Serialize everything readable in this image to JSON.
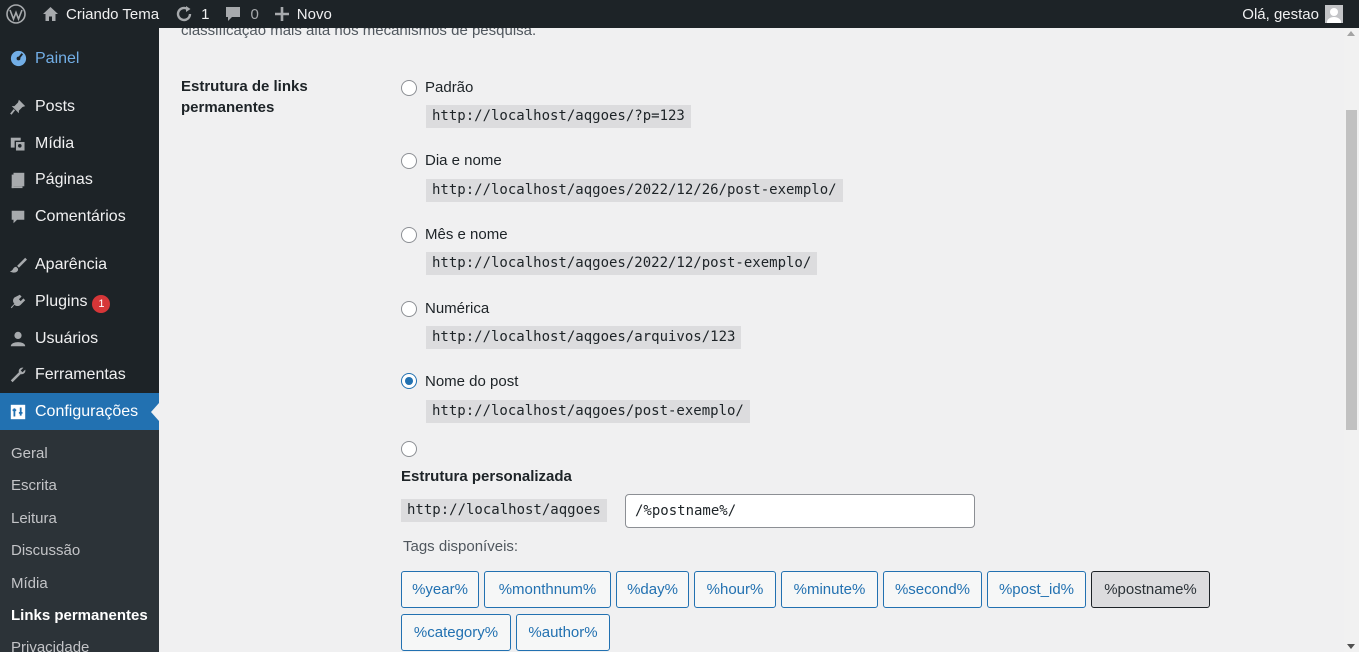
{
  "adminbar": {
    "site_name": "Criando Tema",
    "updates_count": "1",
    "comments_count": "0",
    "new_label": "Novo",
    "greeting": "Olá, gestao"
  },
  "sidebar": {
    "items": [
      {
        "label": "Painel",
        "icon": "dashboard-icon"
      },
      {
        "label": "Posts",
        "icon": "pushpin-icon"
      },
      {
        "label": "Mídia",
        "icon": "media-icon"
      },
      {
        "label": "Páginas",
        "icon": "page-icon"
      },
      {
        "label": "Comentários",
        "icon": "comment-icon"
      },
      {
        "label": "Aparência",
        "icon": "brush-icon"
      },
      {
        "label": "Plugins",
        "icon": "plug-icon",
        "badge": "1"
      },
      {
        "label": "Usuários",
        "icon": "user-icon"
      },
      {
        "label": "Ferramentas",
        "icon": "wrench-icon"
      },
      {
        "label": "Configurações",
        "icon": "settings-icon"
      }
    ],
    "submenu": [
      "Geral",
      "Escrita",
      "Leitura",
      "Discussão",
      "Mídia",
      "Links permanentes",
      "Privacidade"
    ]
  },
  "content": {
    "intro_text": "classificação mais alta nos mecanismos de pesquisa.",
    "row_label": "Estrutura de links permanentes",
    "options": [
      {
        "label": "Padrão",
        "example": "http://localhost/aqgoes/?p=123",
        "checked": false
      },
      {
        "label": "Dia e nome",
        "example": "http://localhost/aqgoes/2022/12/26/post-exemplo/",
        "checked": false
      },
      {
        "label": "Mês e nome",
        "example": "http://localhost/aqgoes/2022/12/post-exemplo/",
        "checked": false
      },
      {
        "label": "Numérica",
        "example": "http://localhost/aqgoes/arquivos/123",
        "checked": false
      },
      {
        "label": "Nome do post",
        "example": "http://localhost/aqgoes/post-exemplo/",
        "checked": true
      }
    ],
    "custom": {
      "title": "Estrutura personalizada",
      "base": "http://localhost/aqgoes",
      "value": "/%postname%/"
    },
    "tags_label": "Tags disponíveis:",
    "tags": [
      "%year%",
      "%monthnum%",
      "%day%",
      "%hour%",
      "%minute%",
      "%second%",
      "%post_id%",
      "%postname%",
      "%category%",
      "%author%"
    ],
    "active_tag": "%postname%"
  },
  "colors": {
    "adminbar_bg": "#1d2327",
    "accent": "#2271b1",
    "badge": "#d63638"
  }
}
